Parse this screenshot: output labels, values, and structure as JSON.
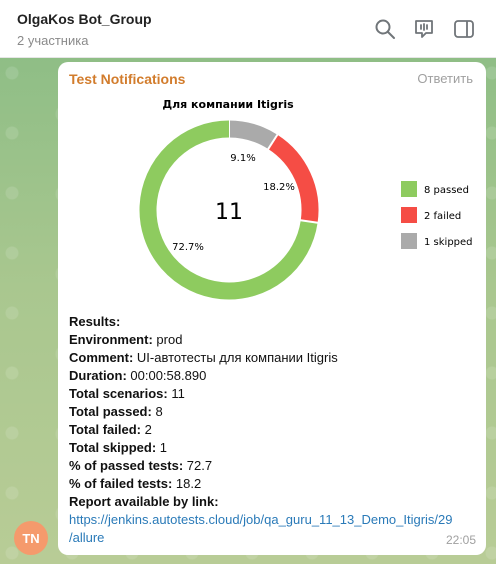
{
  "header": {
    "title": "OlgaKos Bot_Group",
    "subtitle": "2 участника",
    "icons": [
      "search-icon",
      "live-chat-icon",
      "sidebar-toggle-icon"
    ]
  },
  "message": {
    "sender": "Test Notifications",
    "reply_label": "Ответить",
    "time": "22:05",
    "avatar_initials": "TN",
    "avatar_color": "#f59a6c",
    "lines": {
      "results": "Results:",
      "environment_label": "Environment:",
      "environment_value": " prod",
      "comment_label": "Comment:",
      "comment_value": " UI-автотесты для компании Itigris",
      "duration_label": "Duration:",
      "duration_value": " 00:00:58.890",
      "total_scenarios_label": "Total scenarios:",
      "total_scenarios_value": " 11",
      "total_passed_label": "Total passed:",
      "total_passed_value": " 8",
      "total_failed_label": "Total failed:",
      "total_failed_value": " 2",
      "total_skipped_label": "Total skipped:",
      "total_skipped_value": " 1",
      "pct_passed_label": "% of passed tests:",
      "pct_passed_value": " 72.7",
      "pct_failed_label": "% of failed tests:",
      "pct_failed_value": " 18.2",
      "report_label": "Report available by link:",
      "link_line1": "https://jenkins.autotests.cloud/job/qa_guru_11_13_Demo_Itigris/29",
      "link_line2": "/allure"
    }
  },
  "chart_data": {
    "type": "pie",
    "title": "Для компании Itigris",
    "center_label": "11",
    "series": [
      {
        "name": "8 passed",
        "value": 8,
        "percent_label": "72.7%",
        "color": "#8ecb5f"
      },
      {
        "name": "2 failed",
        "value": 2,
        "percent_label": "18.2%",
        "color": "#f54d45"
      },
      {
        "name": "1 skipped",
        "value": 1,
        "percent_label": "9.1%",
        "color": "#aaaaaa"
      }
    ],
    "legend_position": "right"
  }
}
